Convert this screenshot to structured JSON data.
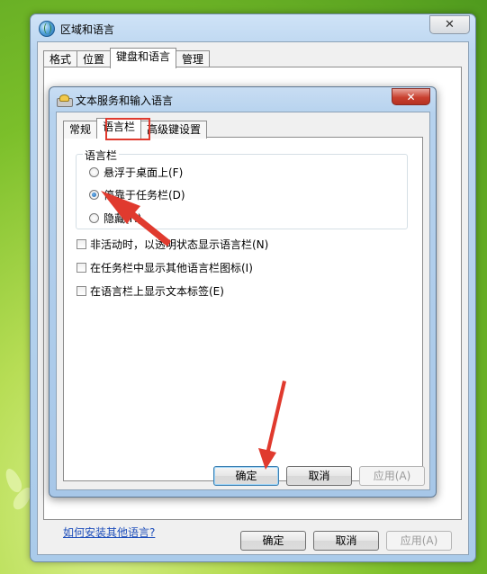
{
  "outer_window": {
    "title": "区域和语言",
    "close_glyph": "✕",
    "tabs": [
      "格式",
      "位置",
      "键盘和语言",
      "管理"
    ],
    "active_tab_index": 2,
    "link": "如何安装其他语言?",
    "buttons": {
      "ok": "确定",
      "cancel": "取消",
      "apply": "应用(A)"
    }
  },
  "inner_dialog": {
    "title": "文本服务和输入语言",
    "close_glyph": "✕",
    "tabs": [
      "常规",
      "语言栏",
      "高级键设置"
    ],
    "active_tab_index": 1,
    "group_title": "语言栏",
    "radio_options": [
      {
        "label": "悬浮于桌面上(F)",
        "checked": false
      },
      {
        "label": "停靠于任务栏(D)",
        "checked": true
      },
      {
        "label": "隐藏(H)",
        "checked": false
      }
    ],
    "checkboxes": [
      {
        "label": "非活动时，以透明状态显示语言栏(N)",
        "checked": false
      },
      {
        "label": "在任务栏中显示其他语言栏图标(I)",
        "checked": false
      },
      {
        "label": "在语言栏上显示文本标签(E)",
        "checked": false
      }
    ],
    "buttons": {
      "ok": "确定",
      "cancel": "取消",
      "apply": "应用(A)"
    }
  },
  "colors": {
    "annotation_red": "#e03a2e",
    "link_blue": "#1c4dba"
  }
}
